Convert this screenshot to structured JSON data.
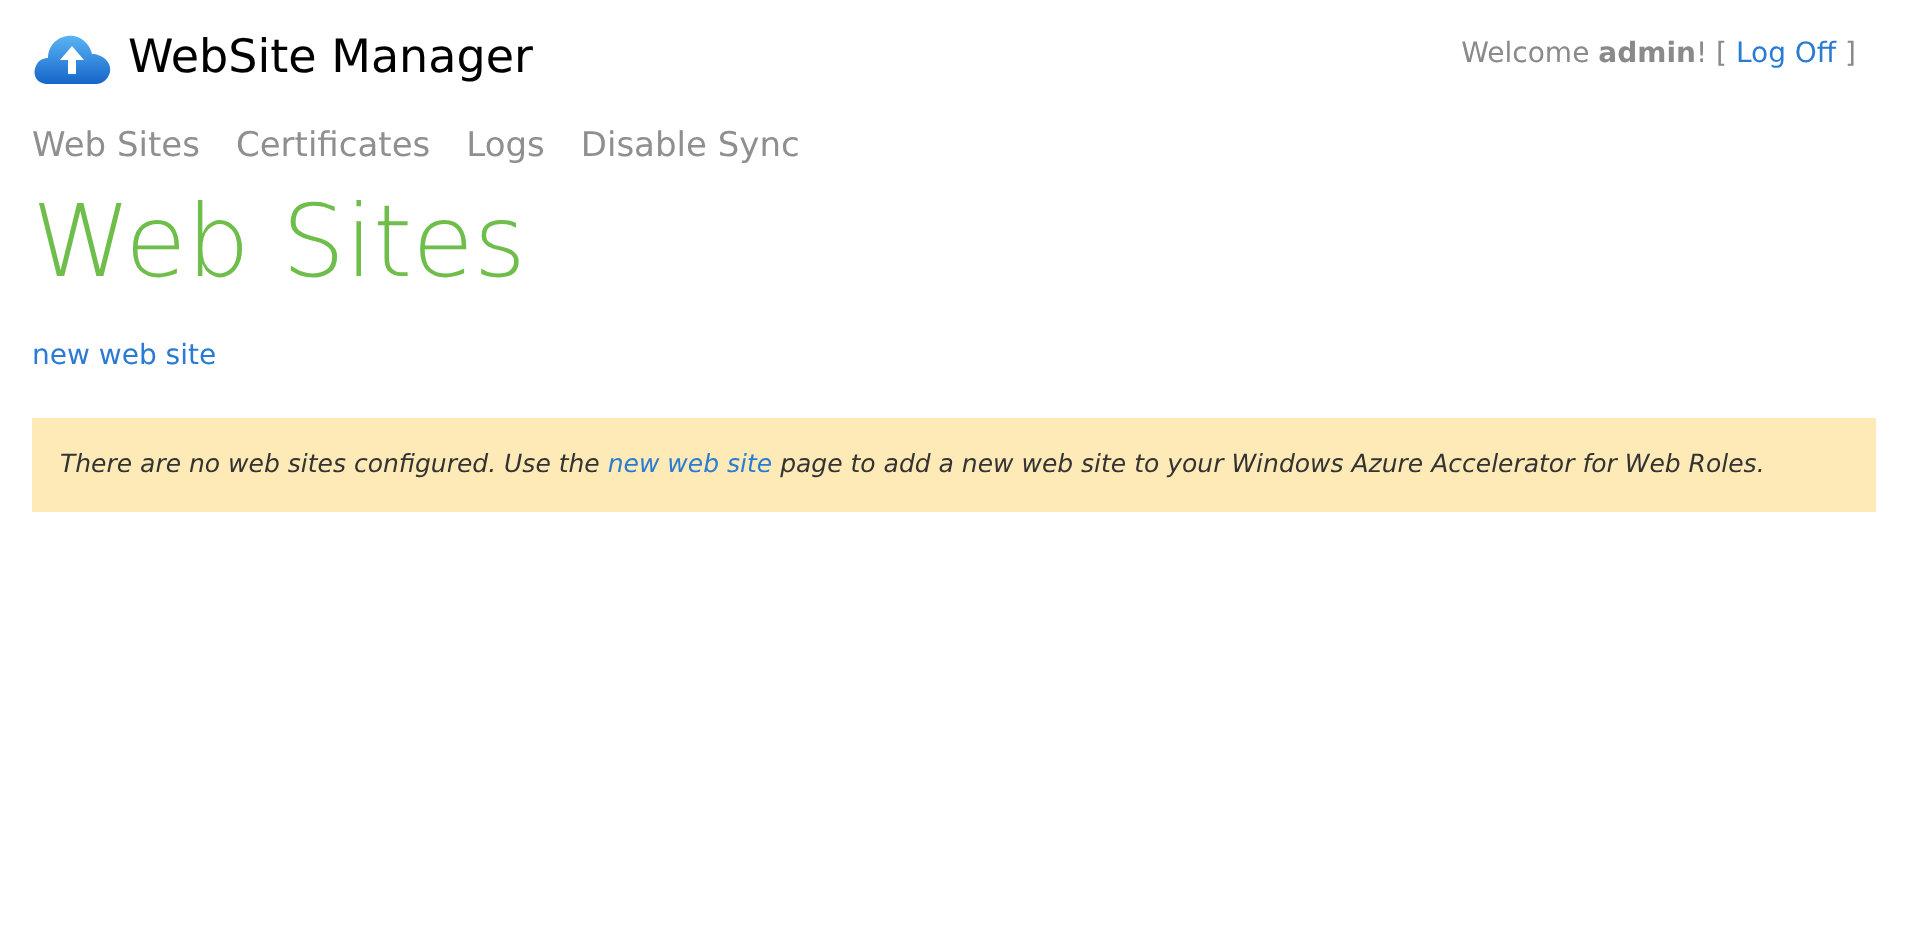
{
  "header": {
    "title": "WebSite Manager",
    "welcome": {
      "before": "Welcome **admin**! [",
      "link": "Log Off",
      "after": "]"
    }
  },
  "nav": [
    {
      "label": "Web Sites"
    },
    {
      "label": "Certificates"
    },
    {
      "label": "Logs"
    },
    {
      "label": "Disable Sync"
    }
  ],
  "page_title": "Web Sites",
  "action_link": "new web site",
  "notice": {
    "before": "There are no web sites configured. Use the",
    "link": "new web site",
    "after": "page to add a new web site to your Windows Azure Accelerator for Web Roles."
  }
}
